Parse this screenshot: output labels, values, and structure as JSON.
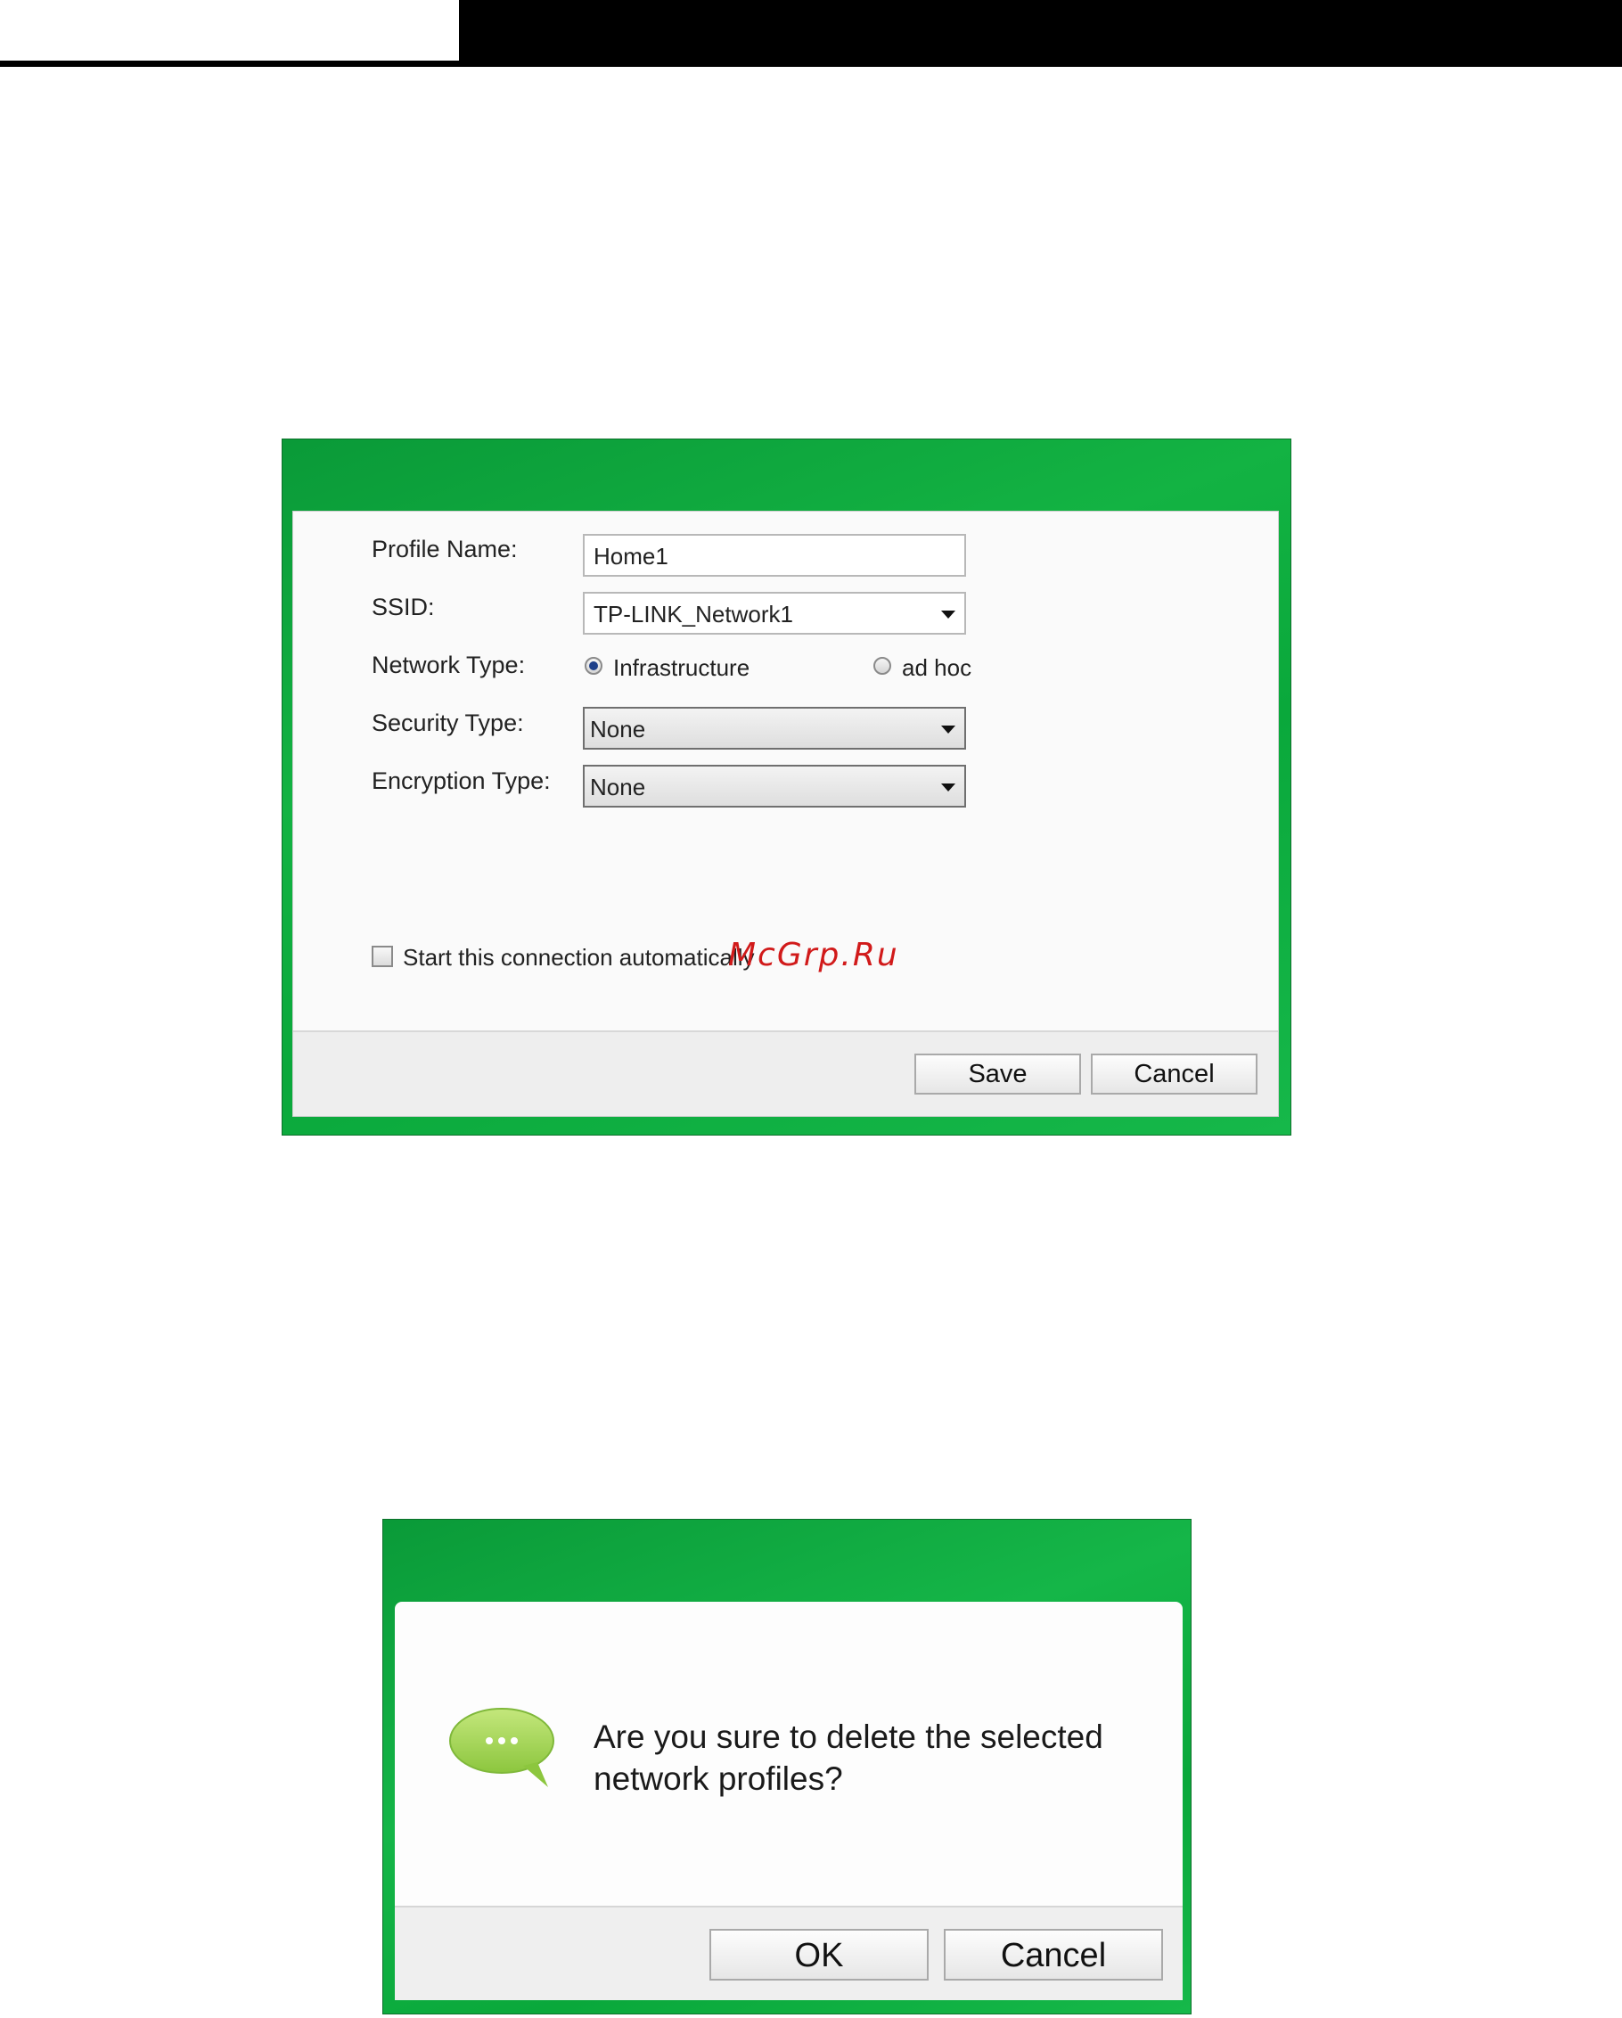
{
  "profile_dialog": {
    "labels": {
      "profile_name": "Profile Name:",
      "ssid": "SSID:",
      "network_type": "Network Type:",
      "security_type": "Security Type:",
      "encryption_type": "Encryption Type:"
    },
    "profile_name_value": "Home1",
    "ssid_value": "TP-LINK_Network1",
    "network_type_options": [
      "Infrastructure",
      "ad hoc"
    ],
    "network_type_selected": "Infrastructure",
    "security_type_value": "None",
    "encryption_type_value": "None",
    "auto_connect_label": "Start this connection automatically",
    "auto_connect_checked": false,
    "save_label": "Save",
    "cancel_label": "Cancel"
  },
  "watermark": "McGrp.Ru",
  "confirm_dialog": {
    "message": "Are you sure to delete the selected network profiles?",
    "ok_label": "OK",
    "cancel_label": "Cancel",
    "icon": "speech-bubble-icon"
  },
  "colors": {
    "dialog_green": "#13b343",
    "bubble_green": "#9ad14b"
  }
}
